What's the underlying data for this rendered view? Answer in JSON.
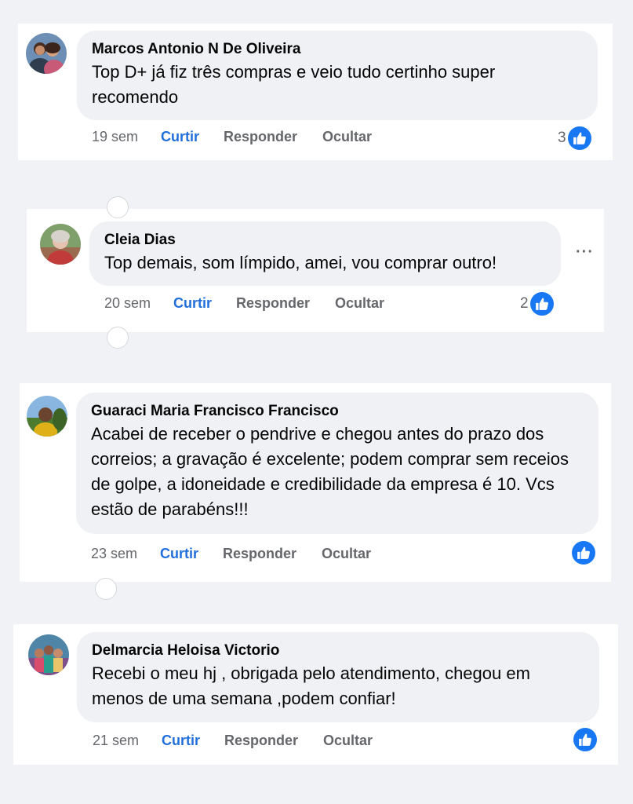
{
  "comments": [
    {
      "author": "Marcos Antonio N De Oliveira",
      "text": "Top D+ já fiz três compras e veio tudo certinho super recomendo",
      "time": "19 sem",
      "like_label": "Curtir",
      "reply_label": "Responder",
      "hide_label": "Ocultar",
      "reaction_count": "3",
      "reaction_icon": "like-icon"
    },
    {
      "author": "Cleia Dias",
      "text": "Top demais, som límpido, amei, vou comprar outro!",
      "time": "20 sem",
      "like_label": "Curtir",
      "reply_label": "Responder",
      "hide_label": "Ocultar",
      "reaction_count": "2",
      "reaction_icon": "like-icon",
      "more_label": "···"
    },
    {
      "author": "Guaraci Maria Francisco Francisco",
      "text": "Acabei de receber o pendrive e chegou antes do prazo dos correios; a gravação é excelente; podem comprar sem receios de golpe, a idoneidade e credibilidade da empresa é 10. Vcs estão de parabéns!!!",
      "time": "23 sem",
      "like_label": "Curtir",
      "reply_label": "Responder",
      "hide_label": "Ocultar",
      "reaction_icon": "like-icon"
    },
    {
      "author": "Delmarcia Heloisa Victorio",
      "text": "Recebi o meu hj , obrigada pelo atendimento, chegou em menos de uma semana ,podem confiar!",
      "time": "21 sem",
      "like_label": "Curtir",
      "reply_label": "Responder",
      "hide_label": "Ocultar",
      "reaction_icon": "like-icon"
    }
  ],
  "colors": {
    "page_background": "#f0f2f5",
    "bubble": "#eff1f4",
    "accent": "#1877f2",
    "like_text": "#216fdb",
    "secondary_text": "#65676b"
  }
}
